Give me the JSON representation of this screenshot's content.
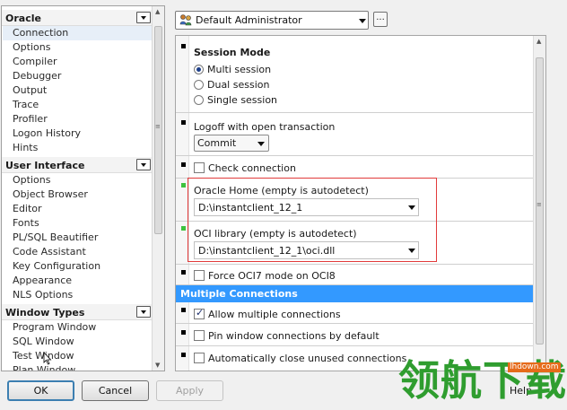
{
  "left_nav": {
    "sections": [
      {
        "title": "Oracle",
        "items": [
          "Connection",
          "Options",
          "Compiler",
          "Debugger",
          "Output",
          "Trace",
          "Profiler",
          "Logon History",
          "Hints"
        ]
      },
      {
        "title": "User Interface",
        "items": [
          "Options",
          "Object Browser",
          "Editor",
          "Fonts",
          "PL/SQL Beautifier",
          "Code Assistant",
          "Key Configuration",
          "Appearance",
          "NLS Options"
        ]
      },
      {
        "title": "Window Types",
        "items": [
          "Program Window",
          "SQL Window",
          "Test Window",
          "Plan Window"
        ]
      }
    ],
    "selected": "Connection"
  },
  "profile": {
    "selected": "Default Administrator",
    "more_label": "..."
  },
  "settings": {
    "session_mode": {
      "title": "Session Mode",
      "options": [
        "Multi session",
        "Dual session",
        "Single session"
      ],
      "selected": "Multi session"
    },
    "logoff": {
      "title": "Logoff with open transaction",
      "value": "Commit"
    },
    "check_connection": {
      "label": "Check connection",
      "checked": false
    },
    "oracle_home": {
      "title": "Oracle Home (empty is autodetect)",
      "value": "D:\\instantclient_12_1"
    },
    "oci_library": {
      "title": "OCI library (empty is autodetect)",
      "value": "D:\\instantclient_12_1\\oci.dll"
    },
    "force_oci7": {
      "label": "Force OCI7 mode on OCI8",
      "checked": false
    },
    "multiple_connections": {
      "title": "Multiple Connections",
      "allow": {
        "label": "Allow multiple connections",
        "checked": true
      },
      "pin": {
        "label": "Pin window connections by default",
        "checked": false
      },
      "auto_close": {
        "label": "Automatically close unused connections",
        "checked": false
      }
    }
  },
  "buttons": {
    "ok": "OK",
    "cancel": "Cancel",
    "apply": "Apply",
    "help_partial": "Help"
  },
  "watermark": {
    "text": "领航下载",
    "url": "lhdown.com"
  },
  "colors": {
    "section_bar": "#3399ff",
    "highlight_border": "#e23b3b",
    "watermark_green": "#2f9d2f",
    "modified_marker": "#3ec23e"
  }
}
